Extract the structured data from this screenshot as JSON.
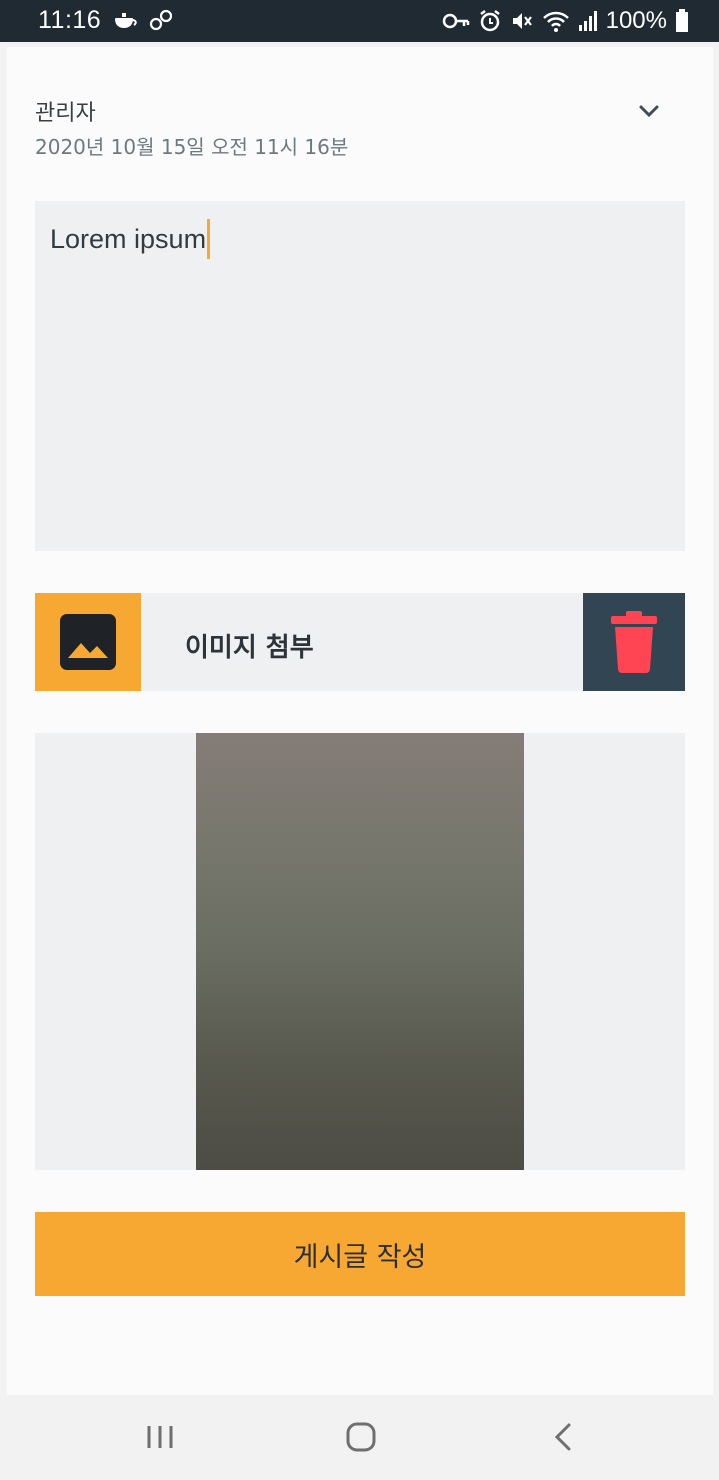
{
  "status_bar": {
    "time": "11:16",
    "battery": "100%",
    "icons": [
      "teapot-icon",
      "link-icon",
      "key-icon",
      "alarm-icon",
      "mute-icon",
      "wifi-icon",
      "signal-icon",
      "battery-icon"
    ]
  },
  "post": {
    "author": "관리자",
    "date": "2020년 10월 15일 오전 11시 16분",
    "content": "Lorem ipsum"
  },
  "attachment": {
    "label": "이미지 첨부"
  },
  "submit": {
    "label": "게시글 작성"
  },
  "colors": {
    "accent": "#f7a833",
    "delete_bg": "#324552",
    "trash": "#ff4453",
    "status_bar": "#1f2a33"
  }
}
